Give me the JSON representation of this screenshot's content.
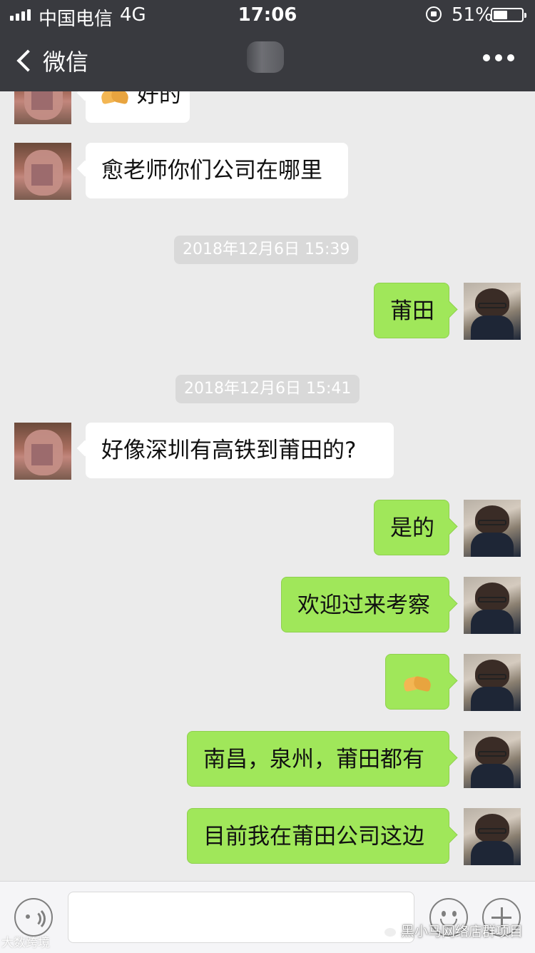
{
  "status_bar": {
    "carrier": "中国电信",
    "network": "4G",
    "time": "17:06",
    "battery_percent": "51%",
    "battery_level": 0.51,
    "signal_bars": 4
  },
  "nav": {
    "back_label": "微信",
    "contact_name": ""
  },
  "messages": [
    {
      "from": "other",
      "text": "好的",
      "emoji": "handshake"
    },
    {
      "from": "other",
      "text": "愈老师你们公司在哪里"
    },
    {
      "type": "time",
      "text": "2018年12月6日 15:39"
    },
    {
      "from": "me",
      "text": "莆田"
    },
    {
      "type": "time",
      "text": "2018年12月6日 15:41"
    },
    {
      "from": "other",
      "text": "好像深圳有高铁到莆田的?"
    },
    {
      "from": "me",
      "text": "是的"
    },
    {
      "from": "me",
      "text": "欢迎过来考察"
    },
    {
      "from": "me",
      "text": "",
      "emoji": "handshake"
    },
    {
      "from": "me",
      "text": "南昌，泉州，莆田都有"
    },
    {
      "from": "me",
      "text": "目前我在莆田公司这边"
    }
  ],
  "input": {
    "placeholder": ""
  },
  "watermarks": {
    "left": "大数跨境",
    "right": "黑小马网络店群项目"
  },
  "colors": {
    "header": "#393a3f",
    "background": "#ebebeb",
    "my_bubble": "#a0e75a",
    "other_bubble": "#ffffff"
  }
}
